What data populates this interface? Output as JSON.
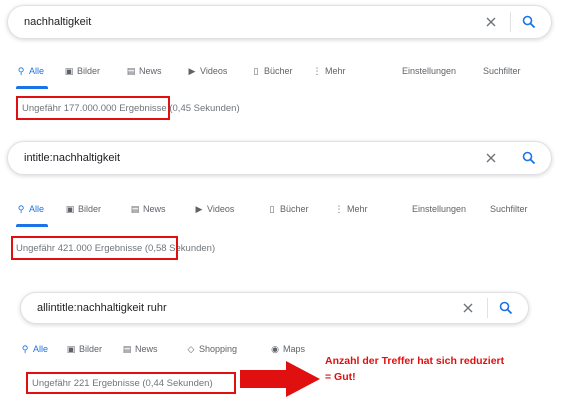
{
  "searches": [
    {
      "query": "nachhaltigkeit",
      "tabs": [
        {
          "icon": "search-icon",
          "label": "Alle",
          "active": true
        },
        {
          "icon": "image-icon",
          "label": "Bilder"
        },
        {
          "icon": "news-icon",
          "label": "News"
        },
        {
          "icon": "video-icon",
          "label": "Videos"
        },
        {
          "icon": "book-icon",
          "label": "Bücher"
        },
        {
          "icon": "more-icon",
          "label": "Mehr"
        },
        {
          "label": "Einstellungen"
        },
        {
          "label": "Suchfilter"
        }
      ],
      "results_count": "Ungefähr 177.000.000 Ergebnisse",
      "results_time": "(0,45 Sekunden)"
    },
    {
      "query": "intitle:nachhaltigkeit",
      "tabs": [
        {
          "icon": "search-icon",
          "label": "Alle",
          "active": true
        },
        {
          "icon": "image-icon",
          "label": "Bilder"
        },
        {
          "icon": "news-icon",
          "label": "News"
        },
        {
          "icon": "video-icon",
          "label": "Videos"
        },
        {
          "icon": "book-icon",
          "label": "Bücher"
        },
        {
          "icon": "more-icon",
          "label": "Mehr"
        },
        {
          "label": "Einstellungen"
        },
        {
          "label": "Suchfilter"
        }
      ],
      "results_count": "Ungefähr 421.000 Ergebnisse",
      "results_time": "(0,58 Sekunden)"
    },
    {
      "query": "allintitle:nachhaltigkeit ruhr",
      "tabs": [
        {
          "icon": "search-icon",
          "label": "Alle",
          "active": true
        },
        {
          "icon": "image-icon",
          "label": "Bilder"
        },
        {
          "icon": "news-icon",
          "label": "News"
        },
        {
          "icon": "shopping-icon",
          "label": "Shopping"
        },
        {
          "icon": "maps-icon",
          "label": "Maps"
        }
      ],
      "results_text": "Ungefähr 221 Ergebnisse (0,44 Sekunden)"
    }
  ],
  "annotation": {
    "line1": "Anzahl der Treffer hat sich reduziert",
    "line2": "= Gut!"
  },
  "colors": {
    "accent": "#1a73e8",
    "highlight": "#e01010",
    "muted": "#5f6368"
  }
}
